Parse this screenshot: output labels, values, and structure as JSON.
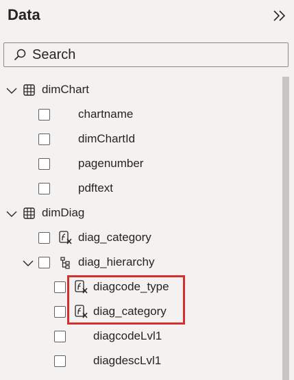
{
  "pane": {
    "title": "Data"
  },
  "search": {
    "placeholder": "Search"
  },
  "tree": {
    "dimChart": {
      "label": "dimChart",
      "fields": [
        "chartname",
        "dimChartId",
        "pagenumber",
        "pdftext"
      ]
    },
    "dimDiag": {
      "label": "dimDiag",
      "measure": "diag_category",
      "hierarchy": {
        "label": "diag_hierarchy",
        "measures": [
          "diagcode_type",
          "diag_category"
        ],
        "fields": [
          "diagcodeLvl1",
          "diagdescLvl1"
        ]
      }
    }
  },
  "colors": {
    "highlight": "#d32f2f",
    "background": "#f3f2f1",
    "scrollbar": "#c8c6c4"
  }
}
